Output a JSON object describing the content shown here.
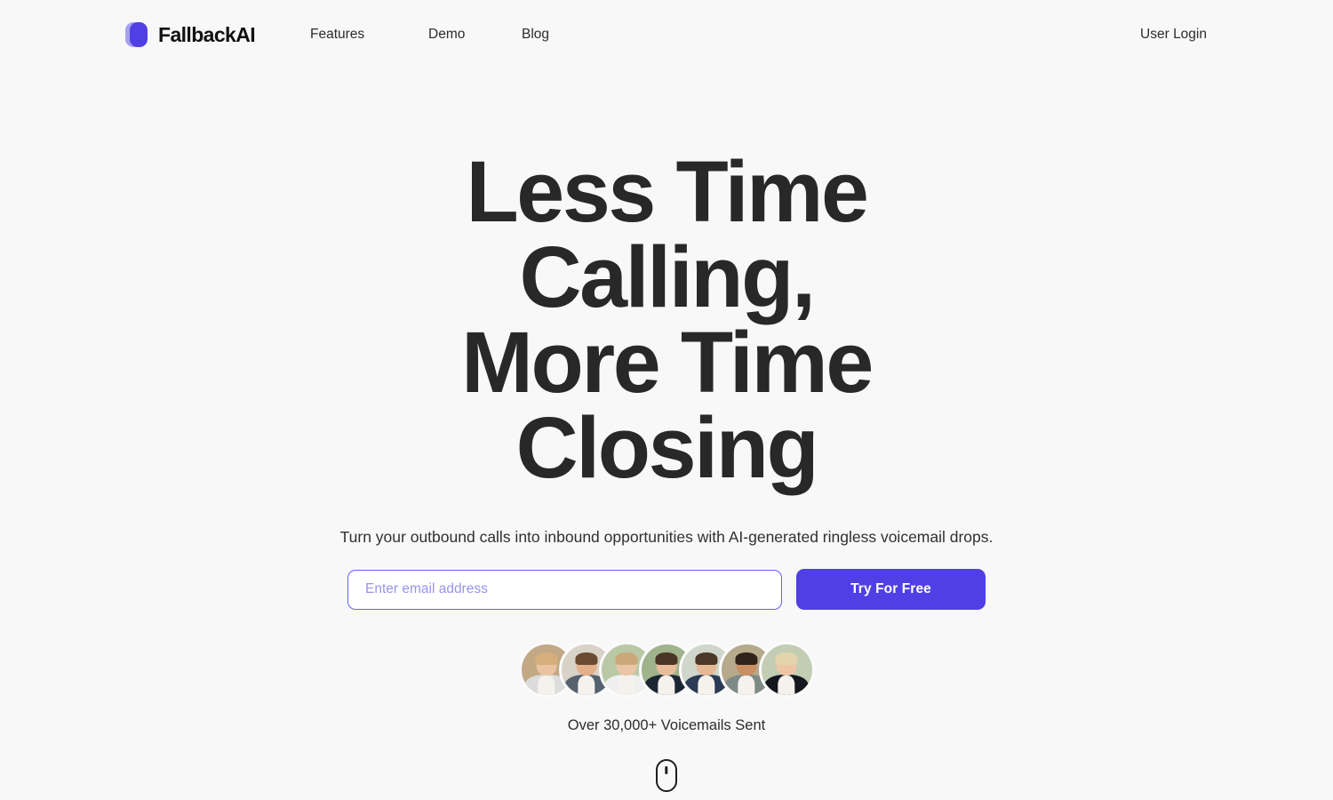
{
  "theme": {
    "page_background": "#f8f8f8",
    "accent": "#4f3fe4",
    "accent_border": "#6a5ff0",
    "placeholder_color": "#9a93ec",
    "headline_color": "#282829"
  },
  "header": {
    "brand": {
      "name": "FallbackAI",
      "logo_icon": "capsule-logo-icon"
    },
    "nav": [
      {
        "label": "Features"
      },
      {
        "label": "Demo"
      },
      {
        "label": "Blog"
      }
    ],
    "user_login_label": "User Login"
  },
  "hero": {
    "headline_lines": [
      "Less Time",
      "Calling,",
      "More Time",
      "Closing"
    ],
    "subheadline": "Turn your outbound calls into inbound opportunities with AI-generated ringless voicemail drops.",
    "form": {
      "email_placeholder": "Enter email address",
      "email_value": "",
      "cta_label": "Try For Free"
    },
    "social_proof_text": "Over 30,000+ Voicemails Sent",
    "avatars": [
      {
        "name": "avatar-person-1",
        "bg": "#c3a886",
        "hair": "#d6ae7c",
        "skin": "#e9c3a2",
        "clothing": "#dcdcdc"
      },
      {
        "name": "avatar-person-2",
        "bg": "#d9d2c6",
        "hair": "#6b4a32",
        "skin": "#e3b089",
        "clothing": "#55616f"
      },
      {
        "name": "avatar-person-3",
        "bg": "#b9c9a6",
        "hair": "#caa878",
        "skin": "#eac5a6",
        "clothing": "#efefef"
      },
      {
        "name": "avatar-person-4",
        "bg": "#9fb48c",
        "hair": "#4a3526",
        "skin": "#e8bd9c",
        "clothing": "#1d2733"
      },
      {
        "name": "avatar-person-5",
        "bg": "#cfd6cb",
        "hair": "#4b3826",
        "skin": "#e5b896",
        "clothing": "#2b3a55"
      },
      {
        "name": "avatar-person-6",
        "bg": "#b6a98c",
        "hair": "#30231a",
        "skin": "#c98f63",
        "clothing": "#7e8a86"
      },
      {
        "name": "avatar-person-7",
        "bg": "#c2cdb3",
        "hair": "#e3d4ae",
        "skin": "#edc6a8",
        "clothing": "#14171d"
      }
    ],
    "scroll_indicator_icon": "mouse-scroll-icon"
  }
}
